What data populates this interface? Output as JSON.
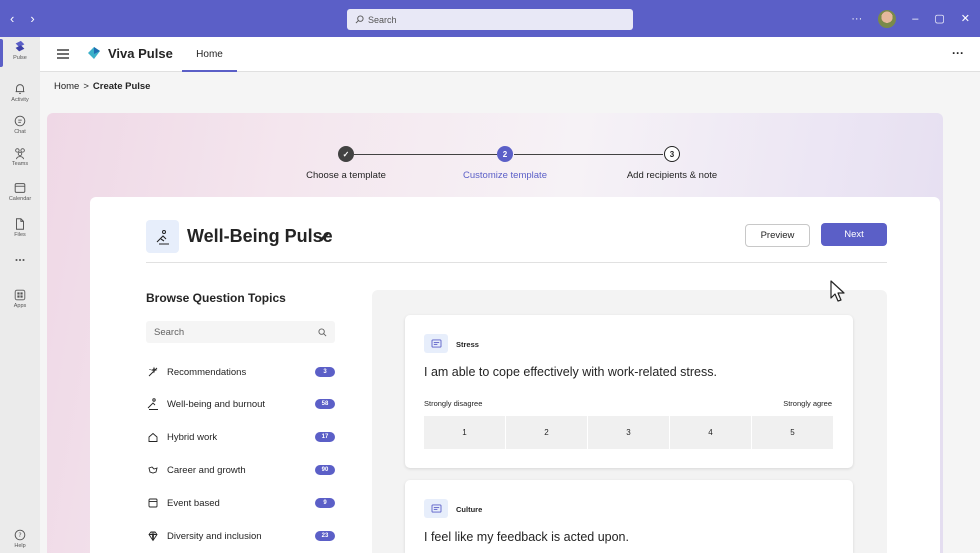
{
  "titlebar": {
    "back": "‹",
    "forward": "›",
    "search_placeholder": "Search",
    "more": "···",
    "minimize": "–",
    "maximize": "▢",
    "close": "✕",
    "color": "#5b5fc7"
  },
  "rail": {
    "items": [
      {
        "label": "Pulse",
        "icon": "pulse-icon"
      },
      {
        "label": "Activity",
        "icon": "bell-icon"
      },
      {
        "label": "Chat",
        "icon": "chat-icon"
      },
      {
        "label": "Teams",
        "icon": "teams-icon"
      },
      {
        "label": "Calendar",
        "icon": "calendar-icon"
      },
      {
        "label": "Files",
        "icon": "file-icon"
      },
      {
        "label": "",
        "icon": "more-icon"
      },
      {
        "label": "Apps",
        "icon": "apps-icon"
      },
      {
        "label": "Help",
        "icon": "help-icon"
      }
    ]
  },
  "header": {
    "app_name": "Viva Pulse",
    "tab": "Home",
    "more": "···"
  },
  "breadcrumb": {
    "home": "Home",
    "separator": ">",
    "current": "Create Pulse"
  },
  "stepper": {
    "steps": [
      {
        "label": "Choose a template",
        "state": "done",
        "marker": "✓"
      },
      {
        "label": "Customize template",
        "state": "current",
        "marker": "2"
      },
      {
        "label": "Add recipients & note",
        "state": "upcoming",
        "marker": "3"
      }
    ]
  },
  "card": {
    "title": "Well-Being Pulse",
    "preview_label": "Preview",
    "next_label": "Next"
  },
  "topics": {
    "heading": "Browse Question Topics",
    "search_placeholder": "Search",
    "items": [
      {
        "label": "Recommendations",
        "count": "3",
        "icon": "sparkle-icon"
      },
      {
        "label": "Well-being and burnout",
        "count": "58",
        "icon": "wellbeing-icon"
      },
      {
        "label": "Hybrid work",
        "count": "17",
        "icon": "home-icon"
      },
      {
        "label": "Career and growth",
        "count": "90",
        "icon": "career-icon"
      },
      {
        "label": "Event based",
        "count": "9",
        "icon": "event-icon"
      },
      {
        "label": "Diversity and inclusion",
        "count": "23",
        "icon": "diamond-icon"
      }
    ]
  },
  "questions": [
    {
      "category": "Stress",
      "text": "I am able to cope effectively with work-related stress.",
      "scale_low": "Strongly disagree",
      "scale_high": "Strongly agree",
      "options": [
        "1",
        "2",
        "3",
        "4",
        "5"
      ]
    },
    {
      "category": "Culture",
      "text": "I feel like my feedback is acted upon."
    }
  ]
}
